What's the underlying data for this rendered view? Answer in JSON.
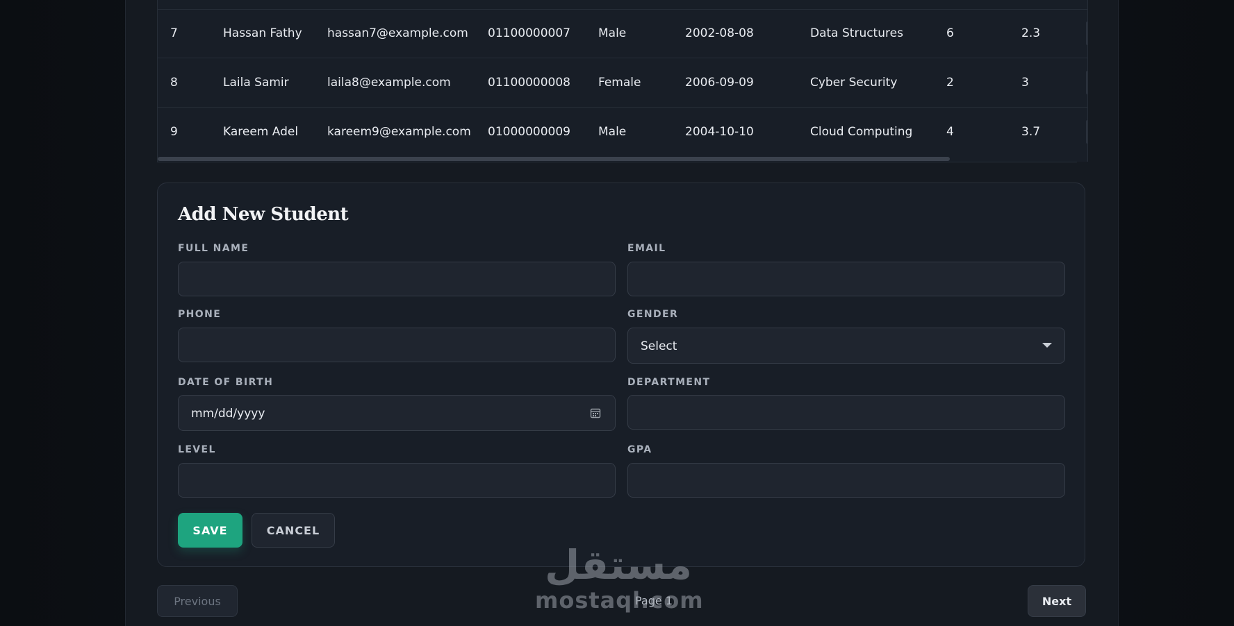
{
  "table": {
    "rows": [
      {
        "id": "7",
        "name": "Hassan Fathy",
        "email": "hassan7@example.com",
        "phone": "01100000007",
        "gender": "Male",
        "dob": "2002-08-08",
        "department": "Data Structures",
        "level": "6",
        "gpa": "2.3"
      },
      {
        "id": "8",
        "name": "Laila Samir",
        "email": "laila8@example.com",
        "phone": "01100000008",
        "gender": "Female",
        "dob": "2006-09-09",
        "department": "Cyber Security",
        "level": "2",
        "gpa": "3"
      },
      {
        "id": "9",
        "name": "Kareem Adel",
        "email": "kareem9@example.com",
        "phone": "01000000009",
        "gender": "Male",
        "dob": "2004-10-10",
        "department": "Cloud Computing",
        "level": "4",
        "gpa": "3.7"
      }
    ]
  },
  "form": {
    "title": "Add New Student",
    "full_name": {
      "label": "FULL NAME",
      "value": ""
    },
    "email": {
      "label": "EMAIL",
      "value": ""
    },
    "phone": {
      "label": "PHONE",
      "value": ""
    },
    "gender": {
      "label": "GENDER",
      "selected": "Select"
    },
    "dob": {
      "label": "DATE OF BIRTH",
      "placeholder": "mm/dd/yyyy"
    },
    "department": {
      "label": "DEPARTMENT",
      "value": ""
    },
    "level": {
      "label": "LEVEL",
      "value": ""
    },
    "gpa": {
      "label": "GPA",
      "value": ""
    },
    "save_label": "SAVE",
    "cancel_label": "CANCEL"
  },
  "pagination": {
    "previous_label": "Previous",
    "page_label": "Page 1",
    "next_label": "Next"
  },
  "watermark": {
    "arabic": "مستقل",
    "latin": "mostaql.com"
  },
  "colors": {
    "accent": "#1ea47f",
    "background": "#151a21",
    "card": "#181e27",
    "input": "#1f252f"
  },
  "icons": {
    "calendar": "calendar-icon",
    "dropdown": "chevron-down-icon"
  }
}
